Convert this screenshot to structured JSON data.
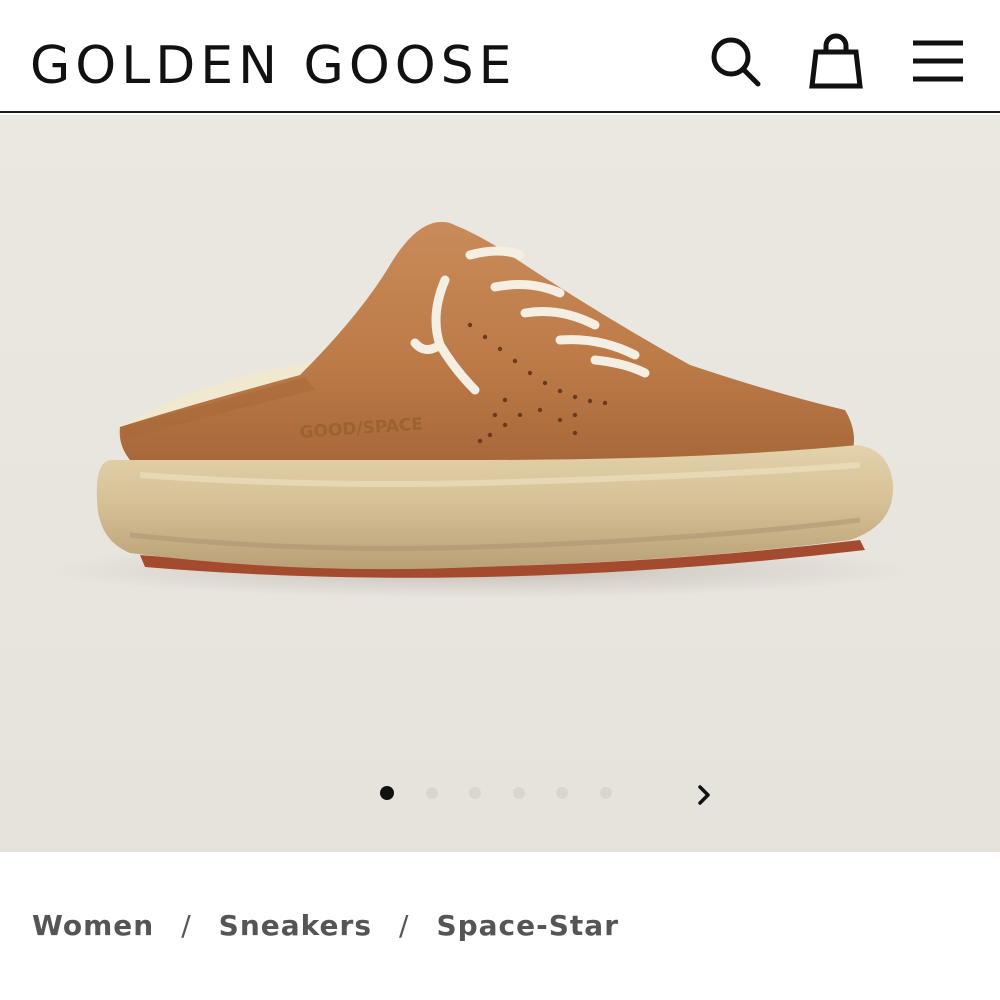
{
  "header": {
    "logo": "GOLDEN GOOSE",
    "search_icon": "search-icon",
    "bag_icon": "shopping-bag-icon",
    "menu_icon": "hamburger-menu-icon"
  },
  "gallery": {
    "image_count": 6,
    "current_index": 1,
    "next_icon": "chevron-right-icon",
    "shoe_print": "GOOD/SPACE"
  },
  "breadcrumb": {
    "items": [
      "Women",
      "Sneakers",
      "Space-Star"
    ],
    "separator": "/"
  },
  "colors": {
    "accent": "#111111",
    "background": "#e9e5df",
    "breadcrumb_text": "#555555",
    "inactive_dot": "#d9d5cf"
  }
}
